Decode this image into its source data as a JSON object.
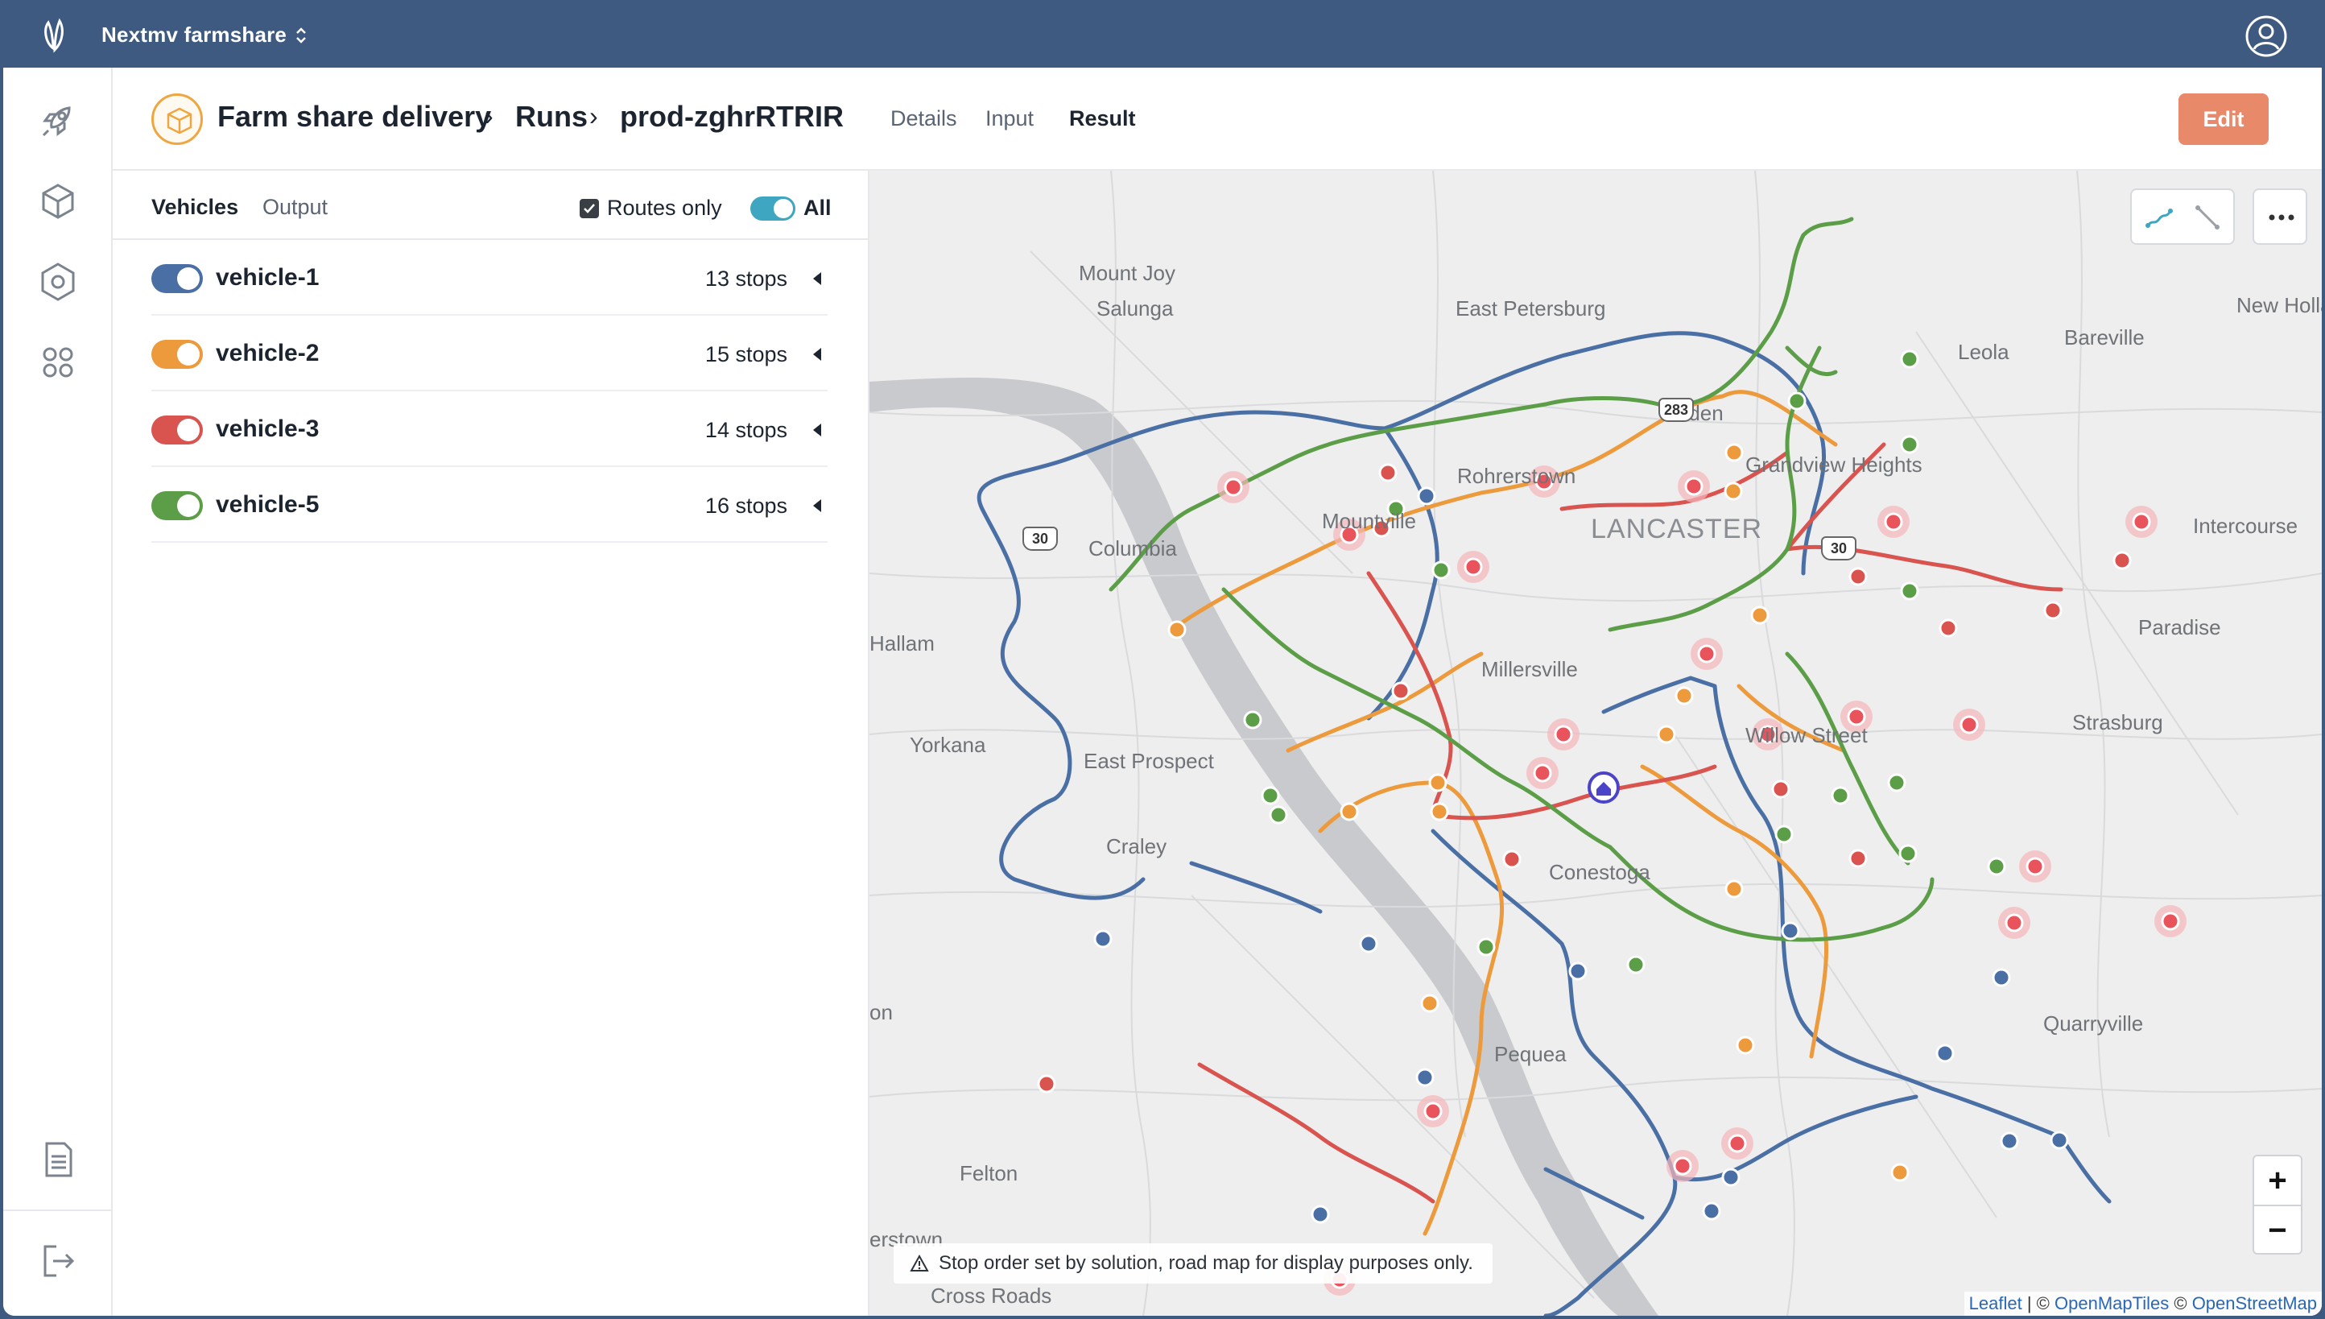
{
  "org": {
    "name": "Nextmv farmshare"
  },
  "breadcrumb": {
    "app": "Farm share delivery",
    "section": "Runs",
    "run": "prod-zghrRTRIR",
    "sep": "›"
  },
  "tabs": {
    "details": "Details",
    "input": "Input",
    "result": "Result"
  },
  "actions": {
    "edit": "Edit"
  },
  "panel": {
    "tab_vehicles": "Vehicles",
    "tab_output": "Output",
    "routes_only": "Routes only",
    "all_label": "All"
  },
  "vehicles": [
    {
      "name": "vehicle-1",
      "stops": "13 stops",
      "color": "#4a6fa5"
    },
    {
      "name": "vehicle-2",
      "stops": "15 stops",
      "color": "#ec9a3c"
    },
    {
      "name": "vehicle-3",
      "stops": "14 stops",
      "color": "#d9534f"
    },
    {
      "name": "vehicle-5",
      "stops": "16 stops",
      "color": "#5c9e48"
    }
  ],
  "map": {
    "places": [
      "Mount Joy",
      "Salunga",
      "East Petersburg",
      "Leola",
      "Bareville",
      "New Holland",
      "Rohrerstown",
      "Eden",
      "Grandview Heights",
      "Intercourse",
      "LANCASTER",
      "Columbia",
      "Mountville",
      "Paradise",
      "Millersville",
      "Willow Street",
      "Strasburg",
      "Yorkana",
      "Hallam",
      "East Prospect",
      "Craley",
      "Conestoga",
      "Quarryville",
      "Pequea",
      "Felton",
      "Cross Roads",
      "erstown",
      "on"
    ],
    "shields": [
      "30",
      "30",
      "30",
      "283"
    ],
    "notice": "Stop order set by solution, road map for display purposes only.",
    "zoom_in": "+",
    "zoom_out": "−",
    "attribution": {
      "leaflet": "Leaflet",
      "sep1": " | © ",
      "omt": "OpenMapTiles",
      "sep2": " © ",
      "osm": "OpenStreetMap"
    }
  }
}
